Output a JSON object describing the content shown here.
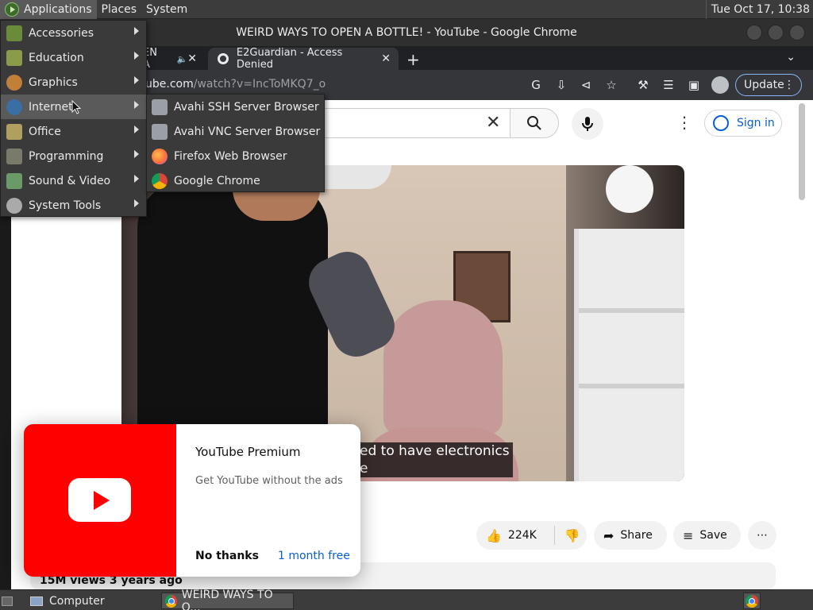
{
  "top_panel": {
    "menus": [
      "Applications",
      "Places",
      "System"
    ],
    "clock": "Tue Oct 17, 10:38"
  },
  "window": {
    "title": "WEIRD WAYS TO OPEN A BOTTLE! - YouTube - Google Chrome"
  },
  "tabs": [
    {
      "label": "EN A"
    },
    {
      "label": "E2Guardian - Access Denied"
    }
  ],
  "omnibox": {
    "url_prefix": "ube.com",
    "url_path": "/watch?v=IncToMKQ7_o"
  },
  "update_button": "Update",
  "youtube": {
    "sign_in": "Sign in",
    "caption_line1": "ed to have electronics",
    "caption_line2": "e",
    "likes": "224K",
    "share": "Share",
    "save": "Save",
    "views": "15M views  3 years ago"
  },
  "premium_popup": {
    "title": "YouTube Premium",
    "subtitle": "Get YouTube without the ads",
    "no_thanks": "No thanks",
    "trial": "1 month free"
  },
  "app_menu": {
    "items": [
      {
        "label": "Accessories",
        "icon": "accessories-icon",
        "color": "#6a8c3a"
      },
      {
        "label": "Education",
        "icon": "education-icon",
        "color": "#8a9b4a"
      },
      {
        "label": "Graphics",
        "icon": "graphics-icon",
        "color": "#c0803a"
      },
      {
        "label": "Internet",
        "icon": "internet-icon",
        "color": "#3a6ea5"
      },
      {
        "label": "Office",
        "icon": "office-icon",
        "color": "#b0a060"
      },
      {
        "label": "Programming",
        "icon": "programming-icon",
        "color": "#7a7a6a"
      },
      {
        "label": "Sound & Video",
        "icon": "sound-video-icon",
        "color": "#6a9a6a"
      },
      {
        "label": "System Tools",
        "icon": "system-tools-icon",
        "color": "#aaaaaa"
      }
    ],
    "highlighted": "Internet"
  },
  "internet_submenu": {
    "items": [
      {
        "label": "Avahi SSH Server Browser",
        "icon": "avahi-ssh-icon",
        "color": "#9aa0a6"
      },
      {
        "label": "Avahi VNC Server Browser",
        "icon": "avahi-vnc-icon",
        "color": "#9aa0a6"
      },
      {
        "label": "Firefox Web Browser",
        "icon": "firefox-icon",
        "color": "#ff7139"
      },
      {
        "label": "Google Chrome",
        "icon": "chrome-icon",
        "color": "#4285f4"
      }
    ]
  },
  "taskbar": {
    "computer": "Computer",
    "window_item": "WEIRD WAYS TO O..."
  }
}
